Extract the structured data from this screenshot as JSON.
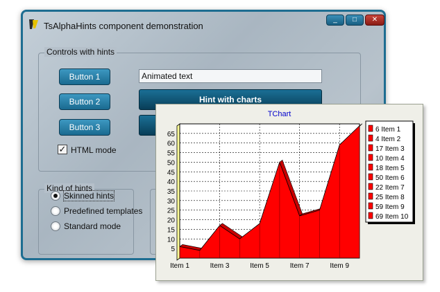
{
  "window": {
    "title": "TsAlphaHints component demonstration",
    "buttons": {
      "minimize": "_",
      "maximize": "□",
      "close": "✕"
    }
  },
  "controls_group": {
    "title": "Controls with hints",
    "buttons": [
      "Button 1",
      "Button 2",
      "Button 3"
    ],
    "edit_value": "Animated text",
    "hint_charts_button": "Hint with charts",
    "html_mode_label": "HTML mode",
    "html_mode_checked": true
  },
  "kind_group": {
    "title": "Kind of hints",
    "options": [
      "Skinned hints",
      "Predefined templates",
      "Standard mode"
    ],
    "selected": 0
  },
  "chart_data": {
    "type": "area",
    "title": "TChart",
    "categories": [
      "Item 1",
      "Item 2",
      "Item 3",
      "Item 4",
      "Item 5",
      "Item 6",
      "Item 7",
      "Item 8",
      "Item 9",
      "Item 10"
    ],
    "x_tick_labels": [
      "Item 1",
      "Item 3",
      "Item 5",
      "Item 7",
      "Item 9"
    ],
    "values": [
      6,
      4,
      17,
      10,
      18,
      50,
      22,
      25,
      59,
      69
    ],
    "ylim": [
      0,
      70
    ],
    "y_ticks": [
      5,
      10,
      15,
      20,
      25,
      30,
      35,
      40,
      45,
      50,
      55,
      60,
      65
    ],
    "grid": true,
    "legend_position": "right",
    "legend": [
      "6 Item 1",
      "4 Item 2",
      "17 Item 3",
      "10 Item 4",
      "18 Item 5",
      "50 Item 6",
      "22 Item 7",
      "25 Item 8",
      "59 Item 9",
      "69 Item 10"
    ],
    "colors": {
      "fill": "#ff0000",
      "top": "#c80000",
      "wall": "#ffff99",
      "frame": "#000000",
      "title": "#0000cc"
    }
  }
}
